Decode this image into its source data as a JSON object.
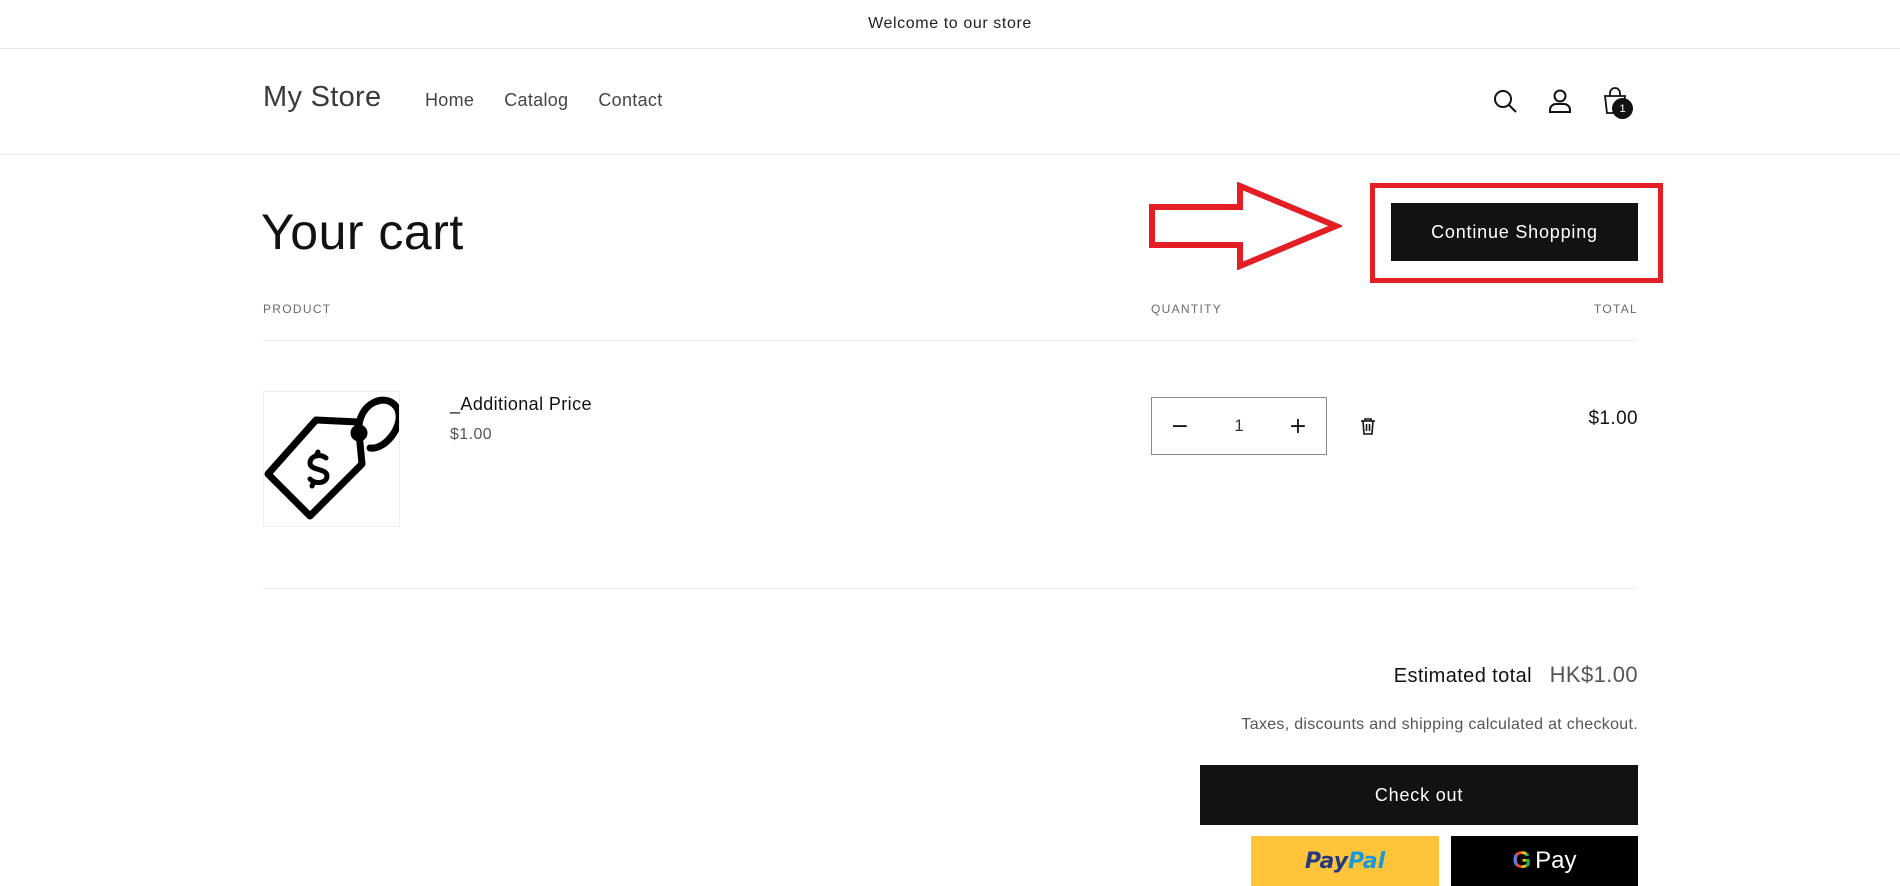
{
  "announcement": "Welcome to our store",
  "header": {
    "logo": "My Store",
    "nav": [
      "Home",
      "Catalog",
      "Contact"
    ],
    "cart_count": "1"
  },
  "cart": {
    "title": "Your cart",
    "continue_label": "Continue Shopping",
    "columns": {
      "product": "PRODUCT",
      "quantity": "QUANTITY",
      "total": "TOTAL"
    },
    "items": [
      {
        "name": "_Additional Price",
        "price": "$1.00",
        "quantity": "1",
        "total": "$1.00"
      }
    ]
  },
  "summary": {
    "estimated_label": "Estimated total",
    "estimated_value": "HK$1.00",
    "tax_note": "Taxes, discounts and shipping calculated at checkout.",
    "checkout_label": "Check out",
    "paypal_label_1": "Pay",
    "paypal_label_2": "Pal",
    "gpay_g": "G",
    "gpay_label": "Pay"
  },
  "annotation": {
    "color": "#e31e24"
  },
  "icons": [
    "search-icon",
    "account-icon",
    "cart-bag-icon",
    "minus-icon",
    "plus-icon",
    "trash-icon",
    "price-tag-icon"
  ]
}
